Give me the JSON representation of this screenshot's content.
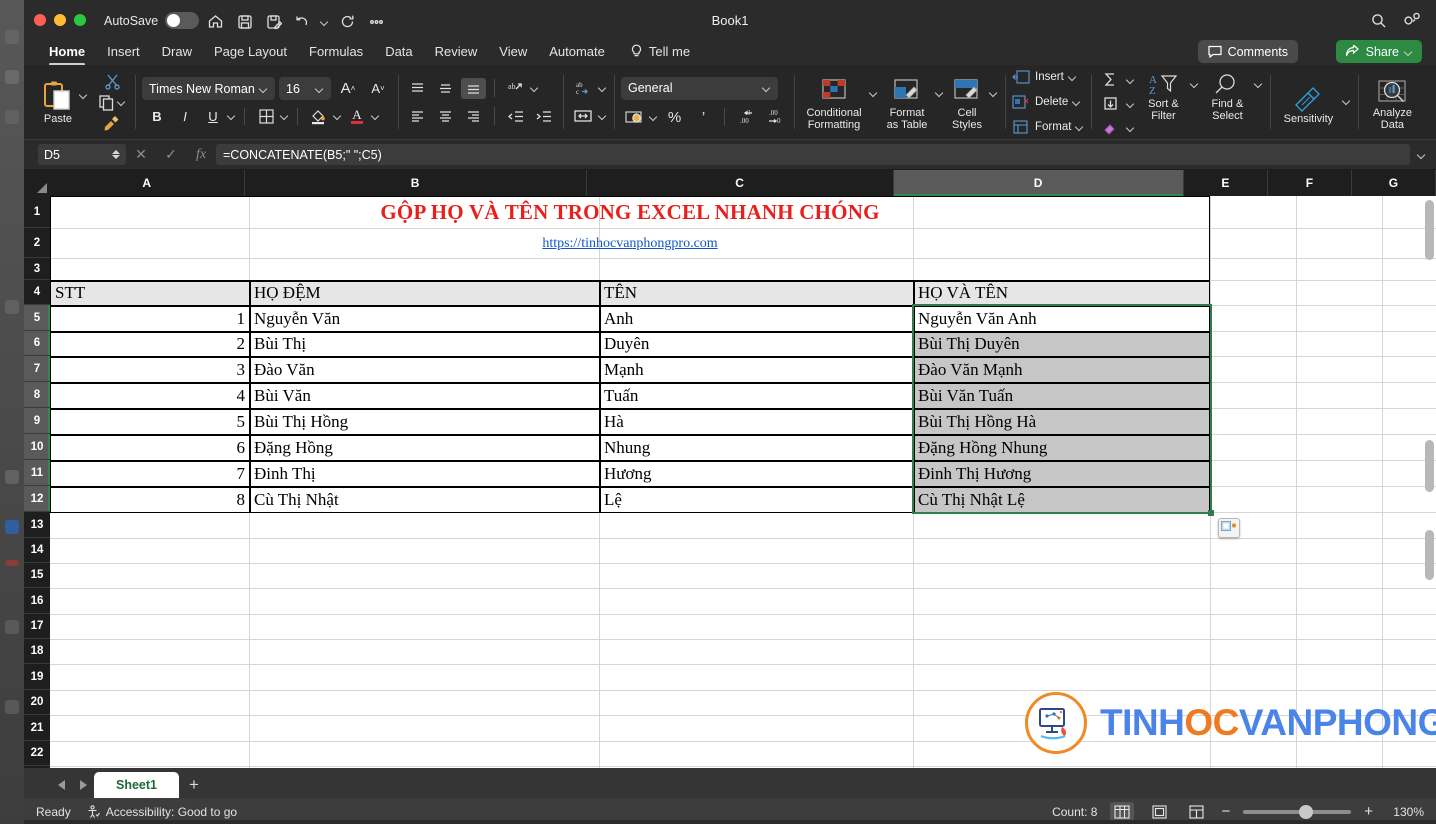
{
  "window": {
    "title": "Book1",
    "autosave_label": "AutoSave",
    "quick_access": [
      "home-icon",
      "save-icon",
      "save-as-icon",
      "undo-icon",
      "redo-icon",
      "more-icon"
    ],
    "search_icon": "search-icon",
    "collab_icon": "collaborate-icon"
  },
  "ribbon_tabs": [
    {
      "label": "Home",
      "active": true
    },
    {
      "label": "Insert",
      "active": false
    },
    {
      "label": "Draw",
      "active": false
    },
    {
      "label": "Page Layout",
      "active": false
    },
    {
      "label": "Formulas",
      "active": false
    },
    {
      "label": "Data",
      "active": false
    },
    {
      "label": "Review",
      "active": false
    },
    {
      "label": "View",
      "active": false
    },
    {
      "label": "Automate",
      "active": false
    }
  ],
  "tell_me": "Tell me",
  "comments_label": "Comments",
  "share_label": "Share",
  "ribbon": {
    "paste_label": "Paste",
    "font_name": "Times New Roman",
    "font_size": "16",
    "bold": "B",
    "italic": "I",
    "underline": "U",
    "number_format": "General",
    "percent": "%",
    "comma": "’",
    "conditional_formatting": "Conditional\nFormatting",
    "conditional_formatting_l1": "Conditional",
    "conditional_formatting_l2": "Formatting",
    "format_as_table_l1": "Format",
    "format_as_table_l2": "as Table",
    "cell_styles_l1": "Cell",
    "cell_styles_l2": "Styles",
    "insert_label": "Insert",
    "delete_label": "Delete",
    "format_label": "Format",
    "sort_filter_l1": "Sort &",
    "sort_filter_l2": "Filter",
    "find_select_l1": "Find &",
    "find_select_l2": "Select",
    "sensitivity_label": "Sensitivity",
    "analyze_data_l1": "Analyze",
    "analyze_data_l2": "Data"
  },
  "formula_bar": {
    "name_box": "D5",
    "formula": "=CONCATENATE(B5;\" \";C5)",
    "cancel_icon": "cancel-icon",
    "confirm_icon": "confirm-icon",
    "fx_icon": "fx-icon"
  },
  "grid": {
    "columns": [
      "A",
      "B",
      "C",
      "D",
      "E",
      "F",
      "G"
    ],
    "selected_column": "D",
    "rows": [
      1,
      2,
      3,
      4,
      5,
      6,
      7,
      8,
      9,
      10,
      11,
      12,
      13,
      14,
      15,
      16,
      17,
      18,
      19,
      20,
      21,
      22
    ],
    "selected_rows": [
      5,
      6,
      7,
      8,
      9,
      10,
      11,
      12
    ],
    "title": "GỘP HỌ VÀ TÊN TRONG EXCEL NHANH CHÓNG",
    "subtitle_link": "https://tinhocvanphongpro.com",
    "headers": {
      "stt": "STT",
      "ho_dem": "HỌ ĐỆM",
      "ten": "TÊN",
      "ho_va_ten": "HỌ VÀ TÊN"
    },
    "table_rows": [
      {
        "stt": "1",
        "ho_dem": "Nguyễn Văn",
        "ten": "Anh",
        "ho_va_ten": "Nguyễn Văn Anh"
      },
      {
        "stt": "2",
        "ho_dem": "Bùi Thị",
        "ten": "Duyên",
        "ho_va_ten": "Bùi Thị Duyên"
      },
      {
        "stt": "3",
        "ho_dem": "Đào Văn",
        "ten": "Mạnh",
        "ho_va_ten": "Đào Văn Mạnh"
      },
      {
        "stt": "4",
        "ho_dem": "Bùi Văn",
        "ten": "Tuấn",
        "ho_va_ten": "Bùi Văn Tuấn"
      },
      {
        "stt": "5",
        "ho_dem": "Bùi Thị Hồng",
        "ten": "Hà",
        "ho_va_ten": "Bùi Thị Hồng Hà"
      },
      {
        "stt": "6",
        "ho_dem": "Đặng Hồng",
        "ten": "Nhung",
        "ho_va_ten": "Đặng Hồng Nhung"
      },
      {
        "stt": "7",
        "ho_dem": "Đinh Thị",
        "ten": "Hương",
        "ho_va_ten": "Đinh Thị Hương"
      },
      {
        "stt": "8",
        "ho_dem": "Cù Thị Nhật",
        "ten": "Lệ",
        "ho_va_ten": "Cù Thị Nhật Lệ"
      }
    ],
    "autofill_icon": "autofill-options-icon"
  },
  "watermark": {
    "text_part1": "TINH",
    "text_part2": "OC",
    "text_part3": "VANPHONG",
    "color_blue": "#4a84e8",
    "color_orange": "#f07a22"
  },
  "sheet_tabs": {
    "tabs": [
      "Sheet1"
    ],
    "active": "Sheet1",
    "add_label": "+"
  },
  "status_bar": {
    "state": "Ready",
    "accessibility": "Accessibility: Good to go",
    "count": "Count: 8",
    "zoom": "130%",
    "minus": "−",
    "plus": "+"
  }
}
